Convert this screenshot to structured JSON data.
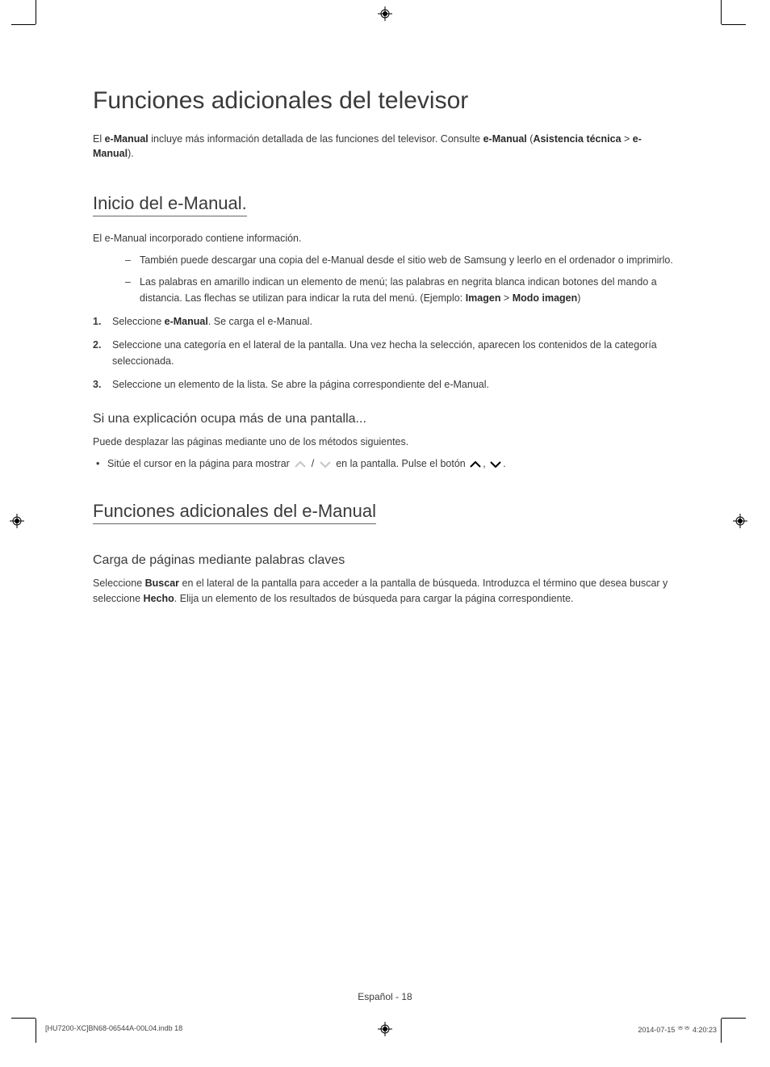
{
  "title": "Funciones adicionales del televisor",
  "intro": {
    "pre": "El ",
    "b1": "e-Manual",
    "mid": " incluye más información detallada de las funciones del televisor. Consulte ",
    "b2": "e-Manual",
    "paren_open": " (",
    "b3": "Asistencia técnica",
    "gt": " > ",
    "b4": "e-Manual",
    "paren_close": ")."
  },
  "sec1": {
    "heading": "Inicio del e-Manual.",
    "p1": "El e-Manual incorporado contiene información.",
    "dash1": "También puede descargar una copia del e-Manual desde el sitio web de Samsung y leerlo en el ordenador o imprimirlo.",
    "dash2_pre": "Las palabras en amarillo indican un elemento de menú; las palabras en negrita blanca indican botones del mando a distancia. Las flechas se utilizan para indicar la ruta del menú. (Ejemplo: ",
    "dash2_b1": "Imagen",
    "dash2_gt": " > ",
    "dash2_b2": "Modo imagen",
    "dash2_post": ")",
    "n1_marker": "1.",
    "n1_pre": "Seleccione ",
    "n1_b": "e-Manual",
    "n1_post": ". Se carga el e-Manual.",
    "n2_marker": "2.",
    "n2": "Seleccione una categoría en el lateral de la pantalla. Una vez hecha la selección, aparecen los contenidos de la categoría seleccionada.",
    "n3_marker": "3.",
    "n3": "Seleccione un elemento de la lista. Se abre la página correspondiente del e-Manual.",
    "sub_heading": "Si una explicación ocupa más de una pantalla...",
    "sub_p": "Puede desplazar las páginas mediante uno de los métodos siguientes.",
    "bullet_pre": "Sitúe el cursor en la página para mostrar ",
    "bullet_mid": " / ",
    "bullet_mid2": " en la pantalla. Pulse el botón ",
    "bullet_comma": ", ",
    "bullet_end": "."
  },
  "sec2": {
    "heading": "Funciones adicionales del e-Manual",
    "sub_heading": "Carga de páginas mediante palabras claves",
    "p_pre": "Seleccione ",
    "p_b1": "Buscar",
    "p_mid": " en el lateral de la pantalla para acceder a la pantalla de búsqueda. Introduzca el término que desea buscar y seleccione ",
    "p_b2": "Hecho",
    "p_post": ". Elija un elemento de los resultados de búsqueda para cargar la página correspondiente."
  },
  "footer": {
    "lang_page": "Español - 18",
    "file": "[HU7200-XC]BN68-06544A-00L04.indb   18",
    "timestamp": "2014-07-15   ᄒᄒ 4:20:23"
  }
}
